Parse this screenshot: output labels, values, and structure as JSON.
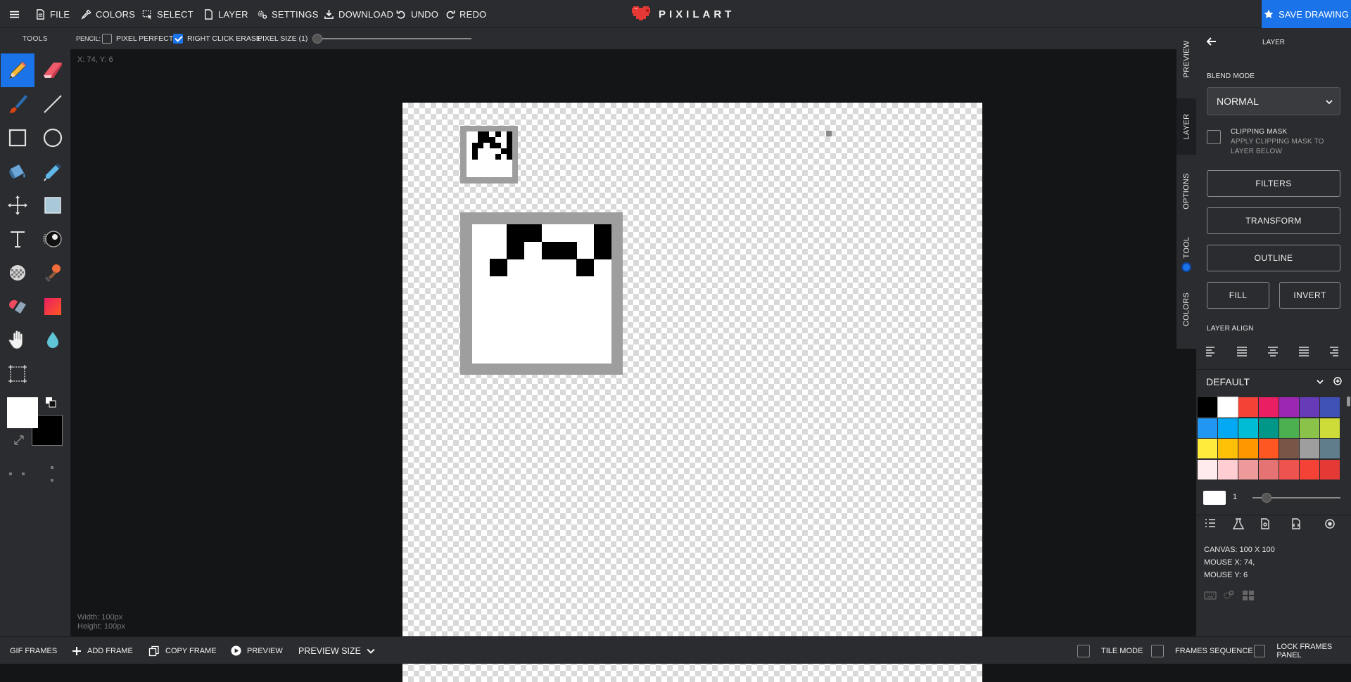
{
  "topbar": {
    "file": "FILE",
    "colors": "COLORS",
    "select": "SELECT",
    "layer": "LAYER",
    "settings": "SETTINGS",
    "download": "DOWNLOAD",
    "undo": "UNDO",
    "redo": "REDO",
    "logo": "PIXILART",
    "save": "SAVE DRAWING"
  },
  "tools": {
    "title": "TOOLS"
  },
  "options": {
    "tool": "PENCIL:",
    "pixel_perfect": "PIXEL PERFECT",
    "pixel_perfect_checked": false,
    "right_click_erase": "RIGHT CLICK ERASE",
    "right_click_erase_checked": true,
    "pixel_size": "PIXEL SIZE (1)",
    "pixel_size_value": 1
  },
  "workspace": {
    "coords": "X: 74, Y: 6",
    "width": "Width: 100px",
    "height": "Height: 100px"
  },
  "vtabs": [
    "PREVIEW",
    "LAYER",
    "OPTIONS",
    "TOOL",
    "COLORS"
  ],
  "panel": {
    "title": "LAYER",
    "blend_mode_label": "BLEND MODE",
    "blend_mode_value": "NORMAL",
    "clipping_mask": "CLIPPING MASK",
    "clipping_mask_desc": "APPLY CLIPPING MASK TO LAYER BELOW",
    "filters": "FILTERS",
    "transform": "TRANSFORM",
    "outline": "OUTLINE",
    "fill": "FILL",
    "invert": "INVERT",
    "layer_align": "LAYER ALIGN",
    "palette_name": "DEFAULT",
    "palette_colors": [
      "#000000",
      "#ffffff",
      "#f44336",
      "#e91e63",
      "#9c27b0",
      "#673ab7",
      "#3f51b5",
      "#2196f3",
      "#03a9f4",
      "#00bcd4",
      "#009688",
      "#4caf50",
      "#8bc34a",
      "#cddc39",
      "#ffeb3b",
      "#ffc107",
      "#ff9800",
      "#ff5722",
      "#795548",
      "#9e9e9e",
      "#607d8b",
      "#ffebee",
      "#ffcdd2",
      "#ef9a9a",
      "#e57373",
      "#ef5350",
      "#f44336",
      "#e53935"
    ],
    "brush_size": "1",
    "canvas_info": "CANVAS: 100 X 100",
    "mouse_x": "MOUSE X: 74,",
    "mouse_y": "MOUSE Y: 6"
  },
  "bottombar": {
    "gif_frames": "GIF FRAMES",
    "add_frame": "ADD FRAME",
    "copy_frame": "COPY FRAME",
    "preview": "PREVIEW",
    "preview_size": "PREVIEW SIZE",
    "tile_mode": "TILE MODE",
    "frames_sequence": "FRAMES SEQUENCE",
    "lock_frames": "LOCK FRAMES PANEL"
  },
  "colors": {
    "accent": "#1a73e8",
    "primary": "#ffffff",
    "secondary": "#000000"
  }
}
